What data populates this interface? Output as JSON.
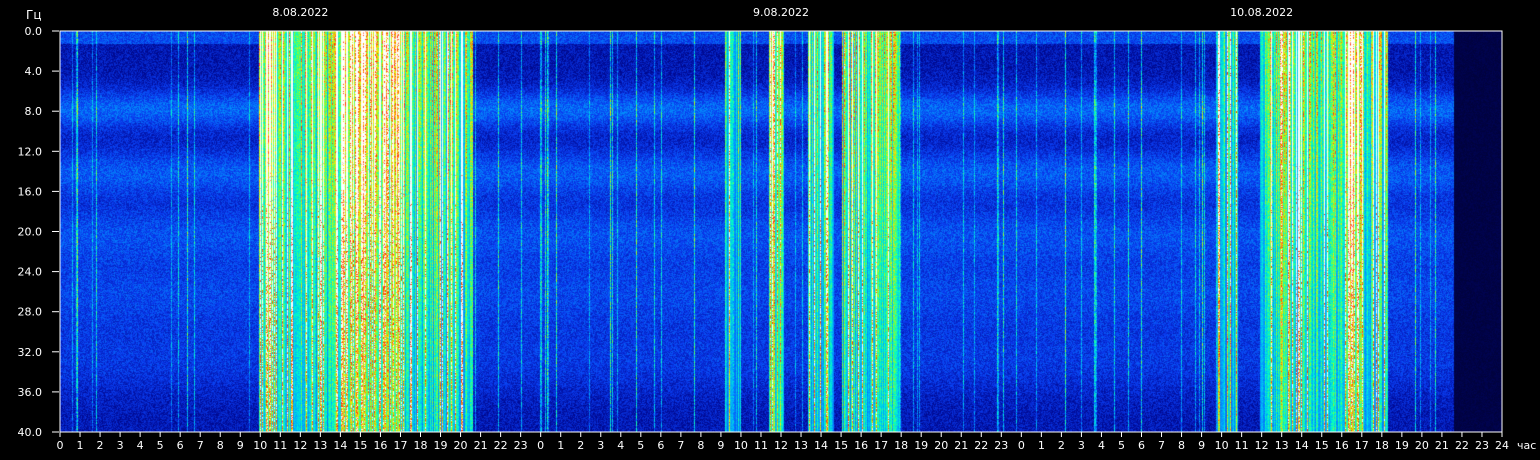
{
  "chart_data": {
    "type": "heatmap",
    "title": "",
    "y_unit": "Гц",
    "x_unit": "час",
    "ylim": [
      0,
      40
    ],
    "y_ticks": [
      "0.0",
      "4.0",
      "8.0",
      "12.0",
      "16.0",
      "20.0",
      "24.0",
      "28.0",
      "32.0",
      "36.0",
      "40.0"
    ],
    "x_ticks": [
      "0",
      "1",
      "2",
      "3",
      "4",
      "5",
      "6",
      "7",
      "8",
      "9",
      "10",
      "11",
      "12",
      "13",
      "14",
      "15",
      "16",
      "17",
      "18",
      "19",
      "20",
      "21",
      "22",
      "23",
      "0",
      "1",
      "2",
      "3",
      "4",
      "5",
      "6",
      "7",
      "8",
      "9",
      "10",
      "11",
      "12",
      "13",
      "14",
      "15",
      "16",
      "17",
      "18",
      "19",
      "20",
      "21",
      "22",
      "23",
      "0",
      "1",
      "2",
      "3",
      "4",
      "5",
      "6",
      "7",
      "8",
      "9",
      "10",
      "11",
      "12",
      "13",
      "14",
      "15",
      "16",
      "17",
      "18",
      "19",
      "20",
      "21",
      "22",
      "23",
      "24"
    ],
    "dates": [
      {
        "label": "8.08.2022",
        "hour": 0
      },
      {
        "label": "9.08.2022",
        "hour": 24
      },
      {
        "label": "10.08.2022",
        "hour": 48
      }
    ],
    "data_end_hour": 69.6,
    "background_bands_hz": [
      7.8,
      14.1,
      20.2,
      26.0,
      32.5
    ],
    "intense_periods": [
      {
        "start_hour": 9.9,
        "end_hour": 20.6,
        "level": 0.75
      },
      {
        "start_hour": 13.9,
        "end_hour": 17.2,
        "level": 1.0
      },
      {
        "start_hour": 33.2,
        "end_hour": 34.0,
        "level": 0.6
      },
      {
        "start_hour": 35.4,
        "end_hour": 36.1,
        "level": 1.0
      },
      {
        "start_hour": 37.3,
        "end_hour": 38.6,
        "level": 0.7
      },
      {
        "start_hour": 39.0,
        "end_hour": 41.9,
        "level": 0.75
      },
      {
        "start_hour": 57.7,
        "end_hour": 58.8,
        "level": 0.6
      },
      {
        "start_hour": 59.9,
        "end_hour": 66.3,
        "level": 0.75
      },
      {
        "start_hour": 60.9,
        "end_hour": 61.5,
        "level": 1.0
      },
      {
        "start_hour": 64.3,
        "end_hour": 65.1,
        "level": 1.0
      }
    ]
  }
}
